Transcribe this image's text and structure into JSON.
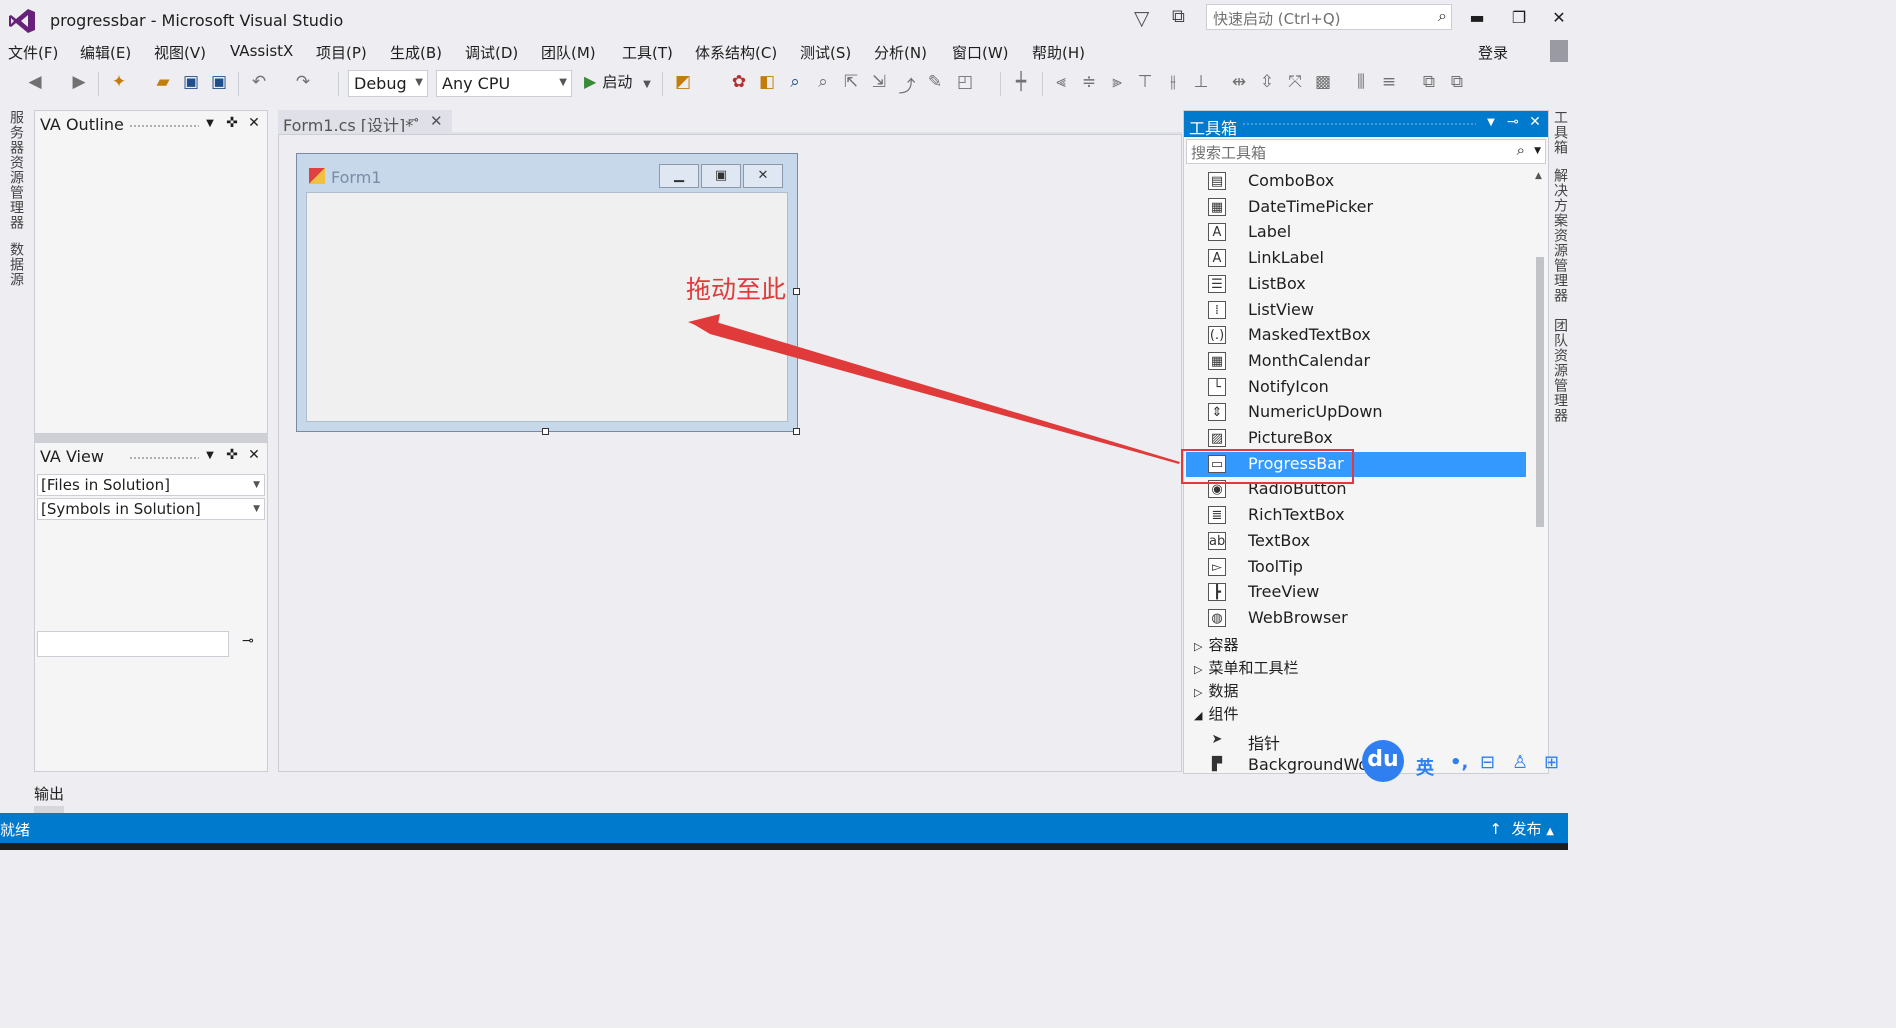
{
  "window": {
    "title": "progressbar - Microsoft Visual Studio"
  },
  "titlebar": {
    "quick_launch_placeholder": "快速启动 (Ctrl+Q)",
    "minimize": "▬",
    "restore": "❐",
    "close": "✕"
  },
  "menu": [
    "文件(F)",
    "编辑(E)",
    "视图(V)",
    "VAssistX",
    "项目(P)",
    "生成(B)",
    "调试(D)",
    "团队(M)",
    "工具(T)",
    "体系结构(C)",
    "测试(S)",
    "分析(N)",
    "窗口(W)",
    "帮助(H)"
  ],
  "account": {
    "login": "登录"
  },
  "toolbar": {
    "config": "Debug",
    "platform": "Any CPU",
    "start": "启动"
  },
  "left_strip": [
    "服务器资源管理器",
    "数据源"
  ],
  "right_strip": [
    "工具箱",
    "解决方案资源管理器",
    "团队资源管理器"
  ],
  "va_outline": {
    "title": "VA Outline"
  },
  "va_view": {
    "title": "VA View",
    "dropdown1": "[Files in Solution]",
    "dropdown2": "[Symbols in Solution]"
  },
  "document": {
    "tab_label": "Form1.cs [设计]*",
    "form_title": "Form1"
  },
  "annotation": {
    "text": "拖动至此"
  },
  "toolbox": {
    "title": "工具箱",
    "search_placeholder": "搜索工具箱",
    "items": [
      {
        "label": "ComboBox",
        "icon": "combobox-icon",
        "glyph": "▤"
      },
      {
        "label": "DateTimePicker",
        "icon": "datetimepicker-icon",
        "glyph": "▦"
      },
      {
        "label": "Label",
        "icon": "label-icon",
        "glyph": "A"
      },
      {
        "label": "LinkLabel",
        "icon": "linklabel-icon",
        "glyph": "A"
      },
      {
        "label": "ListBox",
        "icon": "listbox-icon",
        "glyph": "☰"
      },
      {
        "label": "ListView",
        "icon": "listview-icon",
        "glyph": "⁞"
      },
      {
        "label": "MaskedTextBox",
        "icon": "maskedtextbox-icon",
        "glyph": "(.)"
      },
      {
        "label": "MonthCalendar",
        "icon": "monthcalendar-icon",
        "glyph": "▦"
      },
      {
        "label": "NotifyIcon",
        "icon": "notifyicon-icon",
        "glyph": "└"
      },
      {
        "label": "NumericUpDown",
        "icon": "numericupdown-icon",
        "glyph": "⇕"
      },
      {
        "label": "PictureBox",
        "icon": "picturebox-icon",
        "glyph": "▨"
      },
      {
        "label": "ProgressBar",
        "icon": "progressbar-icon",
        "glyph": "▭"
      },
      {
        "label": "RadioButton",
        "icon": "radiobutton-icon",
        "glyph": "◉"
      },
      {
        "label": "RichTextBox",
        "icon": "richtextbox-icon",
        "glyph": "≣"
      },
      {
        "label": "TextBox",
        "icon": "textbox-icon",
        "glyph": "ab"
      },
      {
        "label": "ToolTip",
        "icon": "tooltip-icon",
        "glyph": "▻"
      },
      {
        "label": "TreeView",
        "icon": "treeview-icon",
        "glyph": "┣"
      },
      {
        "label": "WebBrowser",
        "icon": "webbrowser-icon",
        "glyph": "◍"
      }
    ],
    "selected": "ProgressBar",
    "categories": [
      {
        "label": "容器",
        "arrow": "▷"
      },
      {
        "label": "菜单和工具栏",
        "arrow": "▷"
      },
      {
        "label": "数据",
        "arrow": "▷"
      },
      {
        "label": "组件",
        "arrow": "◢"
      }
    ],
    "component_items": [
      {
        "label": "指针",
        "glyph": "➤"
      },
      {
        "label": "BackgroundWor",
        "glyph": "▛"
      }
    ]
  },
  "output": {
    "label": "输出"
  },
  "status": {
    "text": "就绪",
    "publish": "发布"
  },
  "ime": {
    "logo": "du",
    "lang": "英"
  }
}
